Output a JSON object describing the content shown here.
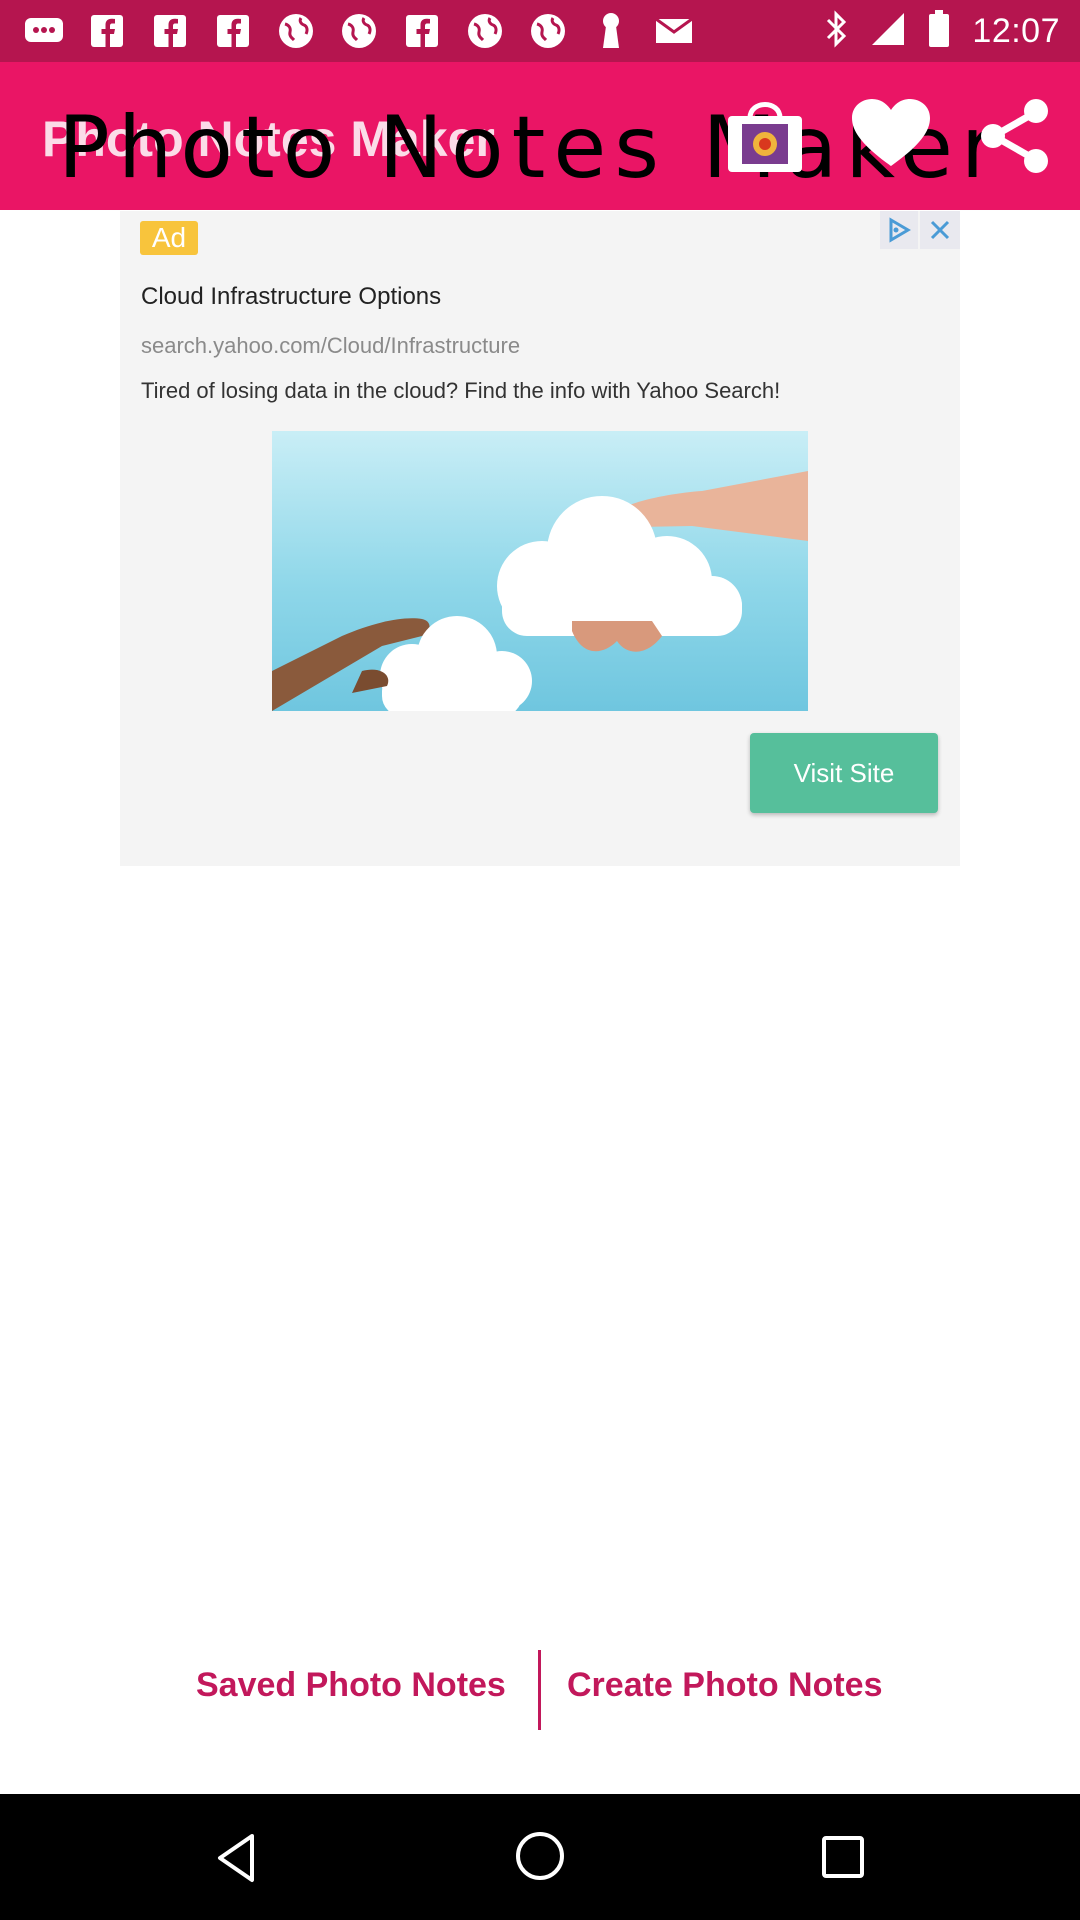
{
  "status_bar": {
    "time": "12:07",
    "notification_icons": [
      "chat-bubble-icon",
      "facebook-icon",
      "facebook-icon",
      "facebook-icon",
      "globe-icon",
      "globe-icon",
      "facebook-icon",
      "globe-icon",
      "globe-icon",
      "keyhole-icon",
      "mail-icon"
    ],
    "right_icons": [
      "bluetooth-icon",
      "signal-icon",
      "battery-icon"
    ]
  },
  "app_bar": {
    "title": "Photo Notes Maker",
    "title_overlay": "Photo Notes Maker",
    "actions": [
      "store-icon",
      "heart-icon",
      "share-icon"
    ]
  },
  "ad": {
    "badge": "Ad",
    "headline": "Cloud Infrastructure Options",
    "url": "search.yahoo.com/Cloud/Infrastructure",
    "description": "Tired of losing data in the cloud? Find the info with Yahoo Search!",
    "cta": "Visit Site"
  },
  "bottom_actions": {
    "saved": "Saved Photo Notes",
    "create": "Create Photo Notes"
  },
  "colors": {
    "status_bar": "#b5154f",
    "app_bar": "#ea1565",
    "accent_text": "#c2185b",
    "cta_button": "#56bf9b",
    "ad_badge": "#f8c43c"
  }
}
